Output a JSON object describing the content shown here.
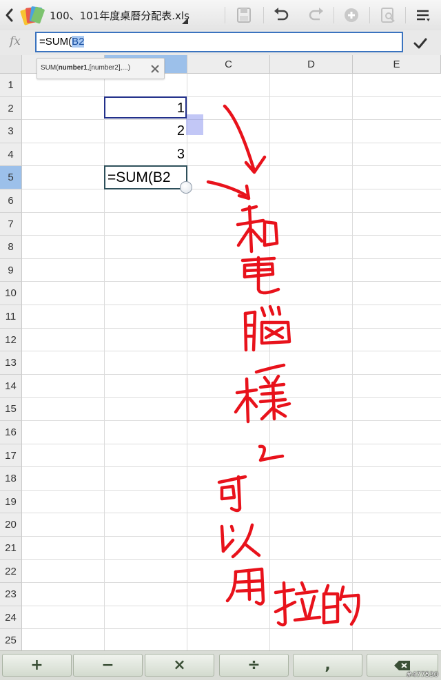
{
  "header": {
    "file_name": "100、101年度桌曆分配表.xls"
  },
  "formula_bar": {
    "fx_label": "fx",
    "formula_prefix": "=SUM(",
    "formula_ref": "B2"
  },
  "tooltip": {
    "fn_name": "SUM(",
    "arg_bold": "number1",
    "arg_rest": ",[number2],...)"
  },
  "sheet": {
    "columns": [
      "C",
      "D",
      "E"
    ],
    "rows": [
      "1",
      "2",
      "3",
      "4",
      "5",
      "6",
      "7",
      "8",
      "9",
      "10",
      "11",
      "12",
      "13",
      "14",
      "15",
      "16",
      "17",
      "18",
      "19",
      "20",
      "21",
      "22",
      "23",
      "24",
      "25"
    ],
    "b2": "1",
    "b3": "2",
    "b4": "3",
    "b5_editing": "=SUM(B2"
  },
  "keypad": {
    "plus": "+",
    "minus": "−",
    "times": "×",
    "divide": "÷",
    "comma": ","
  },
  "watermark": "#477530",
  "handwriting": "和電腦一樣，可以用拉的",
  "colors": {
    "selection_header": "#9cc0ea",
    "formula_border": "#3a73bf",
    "ink": "#e8121b"
  }
}
